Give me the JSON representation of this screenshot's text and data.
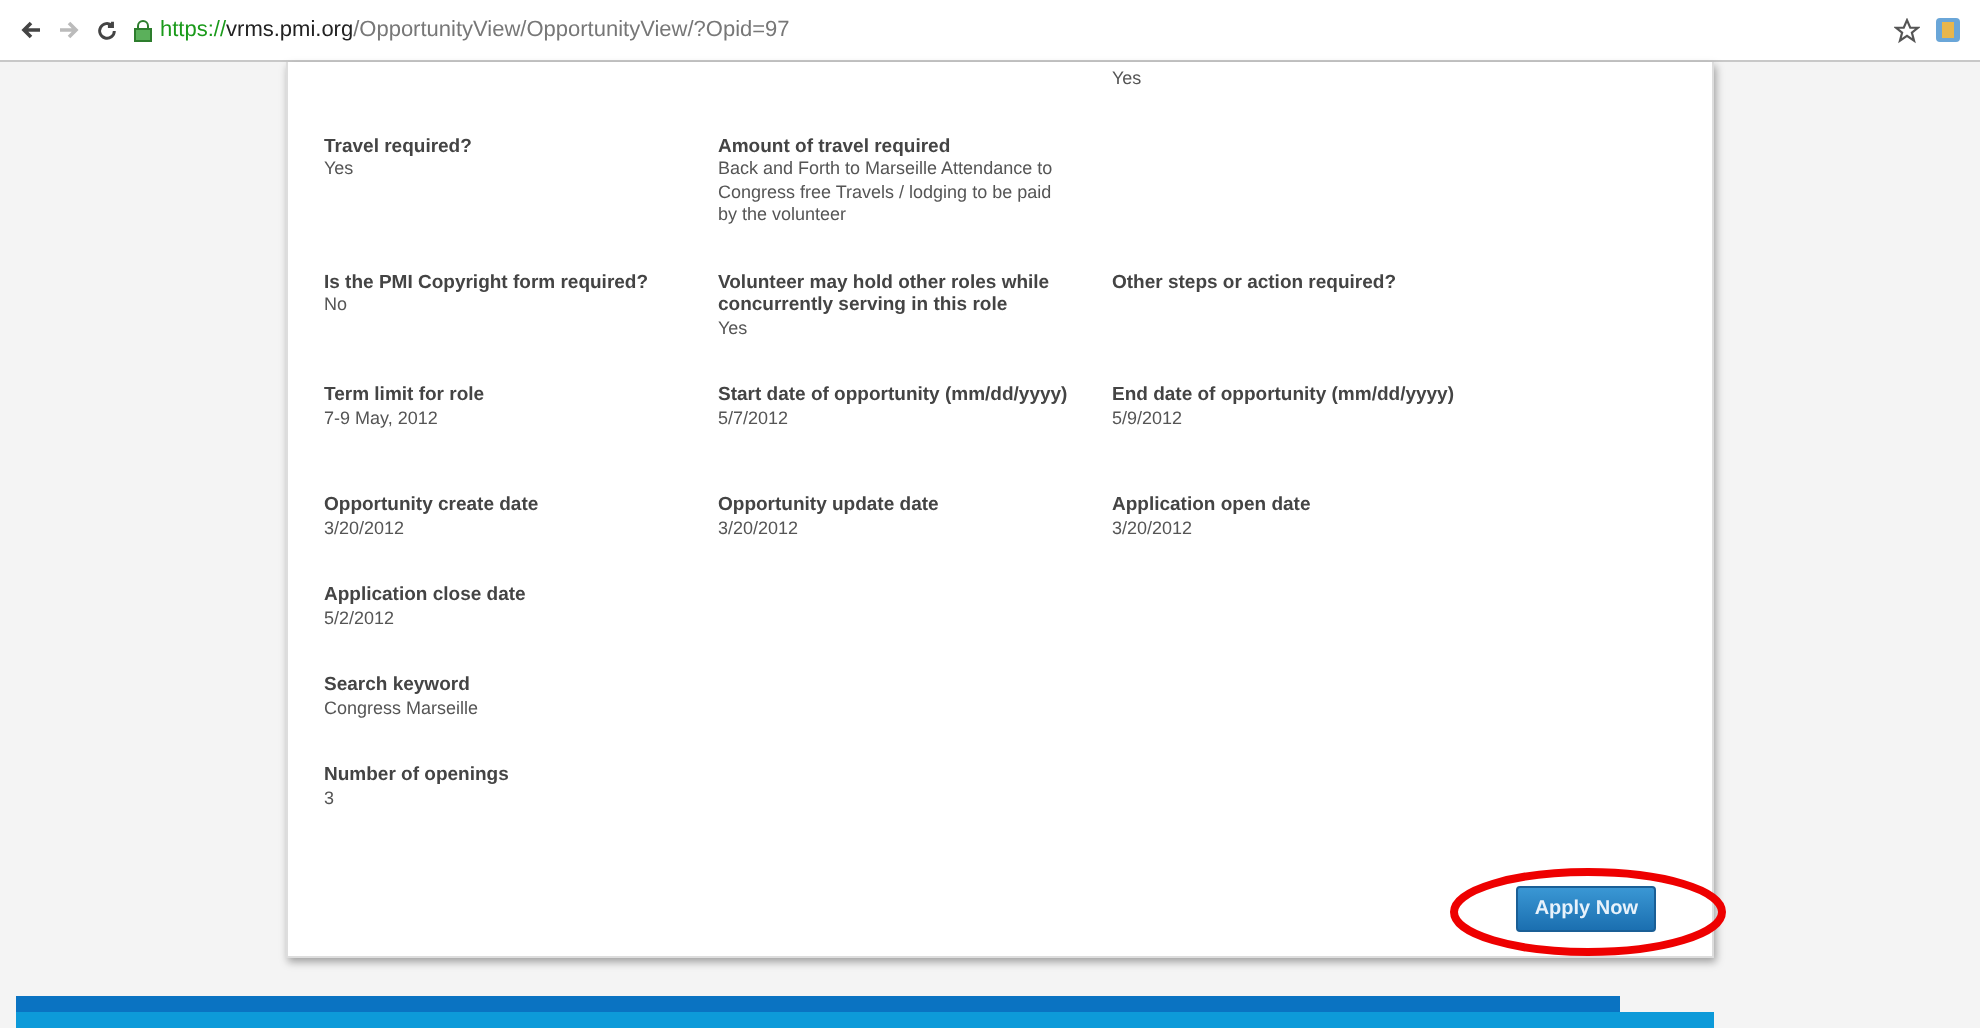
{
  "browser": {
    "url": {
      "scheme": "https://",
      "host": "vrms.pmi.org",
      "path": "/OpportunityView/OpportunityView/?Opid=97"
    }
  },
  "rows": [
    {
      "kind": "continued",
      "fields": [
        {
          "value": "Yes"
        }
      ]
    },
    {
      "fields": [
        {
          "label": "Travel required?",
          "value": "Yes"
        },
        {
          "label": "Amount of travel required",
          "value": "Back and Forth to Marseille Attendance to Congress free Travels / lodging to be paid by the volunteer"
        }
      ]
    },
    {
      "fields": [
        {
          "label": "Is the PMI Copyright form required?",
          "value": "No"
        },
        {
          "label": "Volunteer may hold other roles while concurrently serving in this role",
          "value": "Yes"
        },
        {
          "label": "Other steps or action required?"
        }
      ]
    },
    {
      "fields": [
        {
          "label": "Term limit for role",
          "value": "7-9 May, 2012"
        },
        {
          "label": "Start date of opportunity (mm/dd/yyyy)",
          "value": "5/7/2012"
        },
        {
          "label": "End date of opportunity (mm/dd/yyyy)",
          "value": "5/9/2012"
        }
      ]
    },
    {
      "fields": [
        {
          "label": "Opportunity create date",
          "value": "3/20/2012"
        },
        {
          "label": "Opportunity update date",
          "value": "3/20/2012"
        },
        {
          "label": "Application open date",
          "value": "3/20/2012"
        }
      ]
    },
    {
      "fields": [
        {
          "label": "Application close date",
          "value": "5/2/2012"
        }
      ]
    },
    {
      "fields": [
        {
          "label": "Search keyword",
          "value": "Congress Marseille"
        }
      ]
    },
    {
      "fields": [
        {
          "label": "Number of openings",
          "value": "3"
        }
      ]
    }
  ],
  "apply_button": {
    "label": "Apply Now",
    "highlighted": true
  }
}
